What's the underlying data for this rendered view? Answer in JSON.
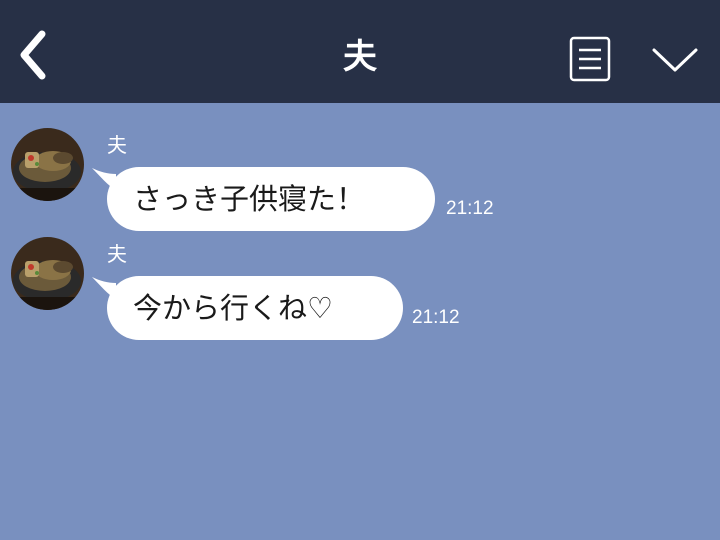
{
  "header": {
    "title": "夫"
  },
  "messages": [
    {
      "sender": "夫",
      "text": "さっき子供寝た！",
      "time": "21:12"
    },
    {
      "sender": "夫",
      "text": "今から行くね♡",
      "time": "21:12"
    }
  ],
  "colors": {
    "header_bg": "#273046",
    "chat_bg": "#7990bf",
    "bubble_bg": "#ffffff"
  },
  "icons": {
    "back": "back-chevron-icon",
    "menu": "menu-list-icon",
    "collapse": "chevron-down-icon",
    "avatar": "food-photo-avatar"
  }
}
